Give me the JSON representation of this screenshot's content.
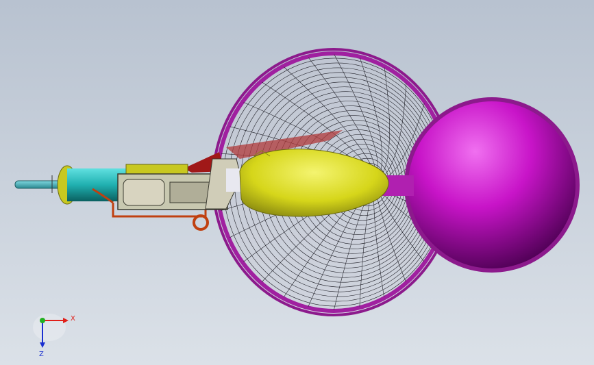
{
  "view": {
    "background_top": "#b8c2d0",
    "background_bottom": "#dbe1e8"
  },
  "triad": {
    "x_label": "X",
    "z_label": "Z",
    "x_color": "#e0201a",
    "z_color": "#1a2fd0",
    "y_color": "#22b020"
  },
  "parts": [
    {
      "name": "propeller-disc",
      "color": "#a020a0"
    },
    {
      "name": "spherical-pod",
      "color": "#c814c8"
    },
    {
      "name": "fuselage-body",
      "color": "#d6d61a"
    },
    {
      "name": "motor-cylinder",
      "color": "#20b0b0"
    },
    {
      "name": "gimbal-frame",
      "color": "#c8c8b0"
    },
    {
      "name": "fin-panel",
      "color": "#b02020"
    },
    {
      "name": "hose-line",
      "color": "#c04010"
    }
  ]
}
